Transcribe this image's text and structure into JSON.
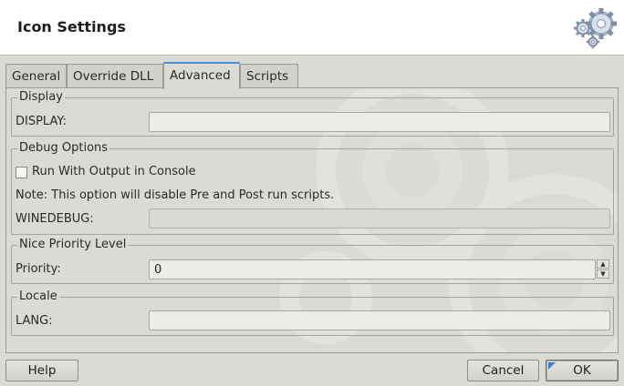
{
  "window": {
    "title": "Icon Settings",
    "icon": "gears-icon"
  },
  "tabs": [
    {
      "label": "General",
      "active": false
    },
    {
      "label": "Override DLL",
      "active": false
    },
    {
      "label": "Advanced",
      "active": true
    },
    {
      "label": "Scripts",
      "active": false
    }
  ],
  "display": {
    "legend": "Display",
    "label": "DISPLAY:",
    "value": ""
  },
  "debug": {
    "legend": "Debug Options",
    "checkbox_label": "Run With Output in Console",
    "checked": false,
    "note": "Note: This option will disable Pre and Post run scripts.",
    "winedebug_label": "WINEDEBUG:",
    "winedebug_value": ""
  },
  "priority": {
    "legend": "Nice Priority Level",
    "label": "Priority:",
    "value": "0"
  },
  "locale": {
    "legend": "Locale",
    "label": "LANG:",
    "value": ""
  },
  "buttons": {
    "help": "Help",
    "cancel": "Cancel",
    "ok": "OK"
  },
  "colors": {
    "accent": "#4a90d9",
    "background": "#dcdad5"
  }
}
